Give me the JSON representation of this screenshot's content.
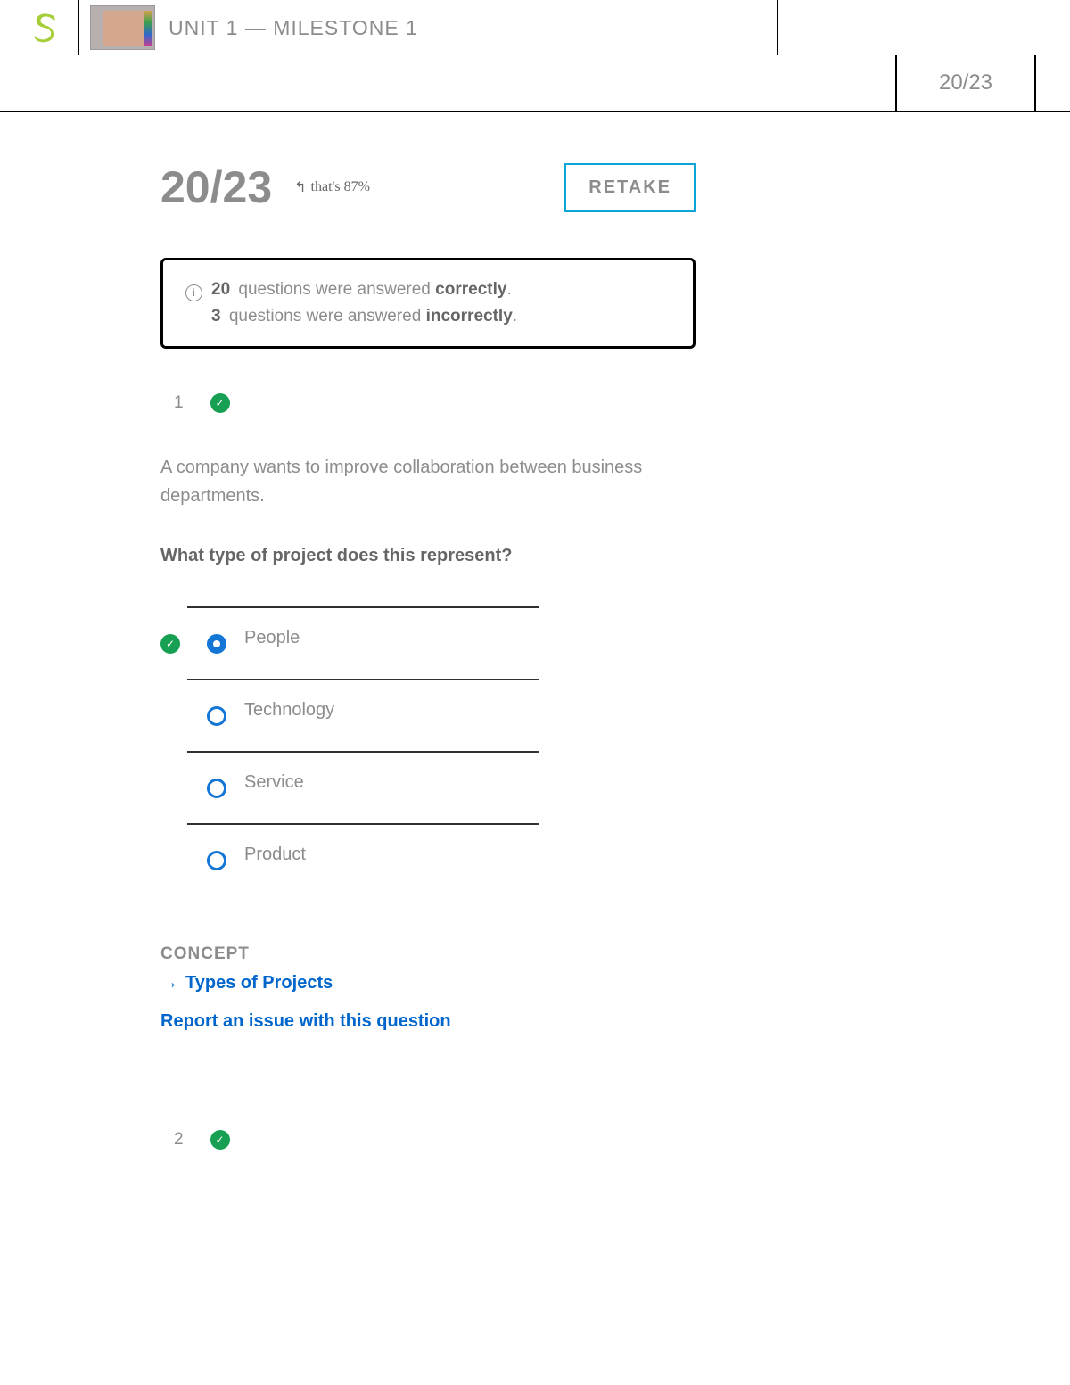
{
  "header": {
    "title": "UNIT 1 — MILESTONE 1",
    "score_compact": "20/23"
  },
  "score": {
    "display": "20/23",
    "percent_note": "that's 87%",
    "retake_label": "RETAKE"
  },
  "summary": {
    "correct_count": "20",
    "correct_text": "questions were answered",
    "correct_word": "correctly",
    "incorrect_count": "3",
    "incorrect_text": "questions were answered",
    "incorrect_word": "incorrectly"
  },
  "question1": {
    "number": "1",
    "text": "A company wants to improve collaboration between business departments.",
    "prompt": "What type of project does this represent?",
    "options": {
      "a": "People",
      "b": "Technology",
      "c": "Service",
      "d": "Product"
    },
    "concept_label": "CONCEPT",
    "concept_link": "Types of Projects",
    "report_link": "Report an issue with this question"
  },
  "question2": {
    "number": "2"
  }
}
